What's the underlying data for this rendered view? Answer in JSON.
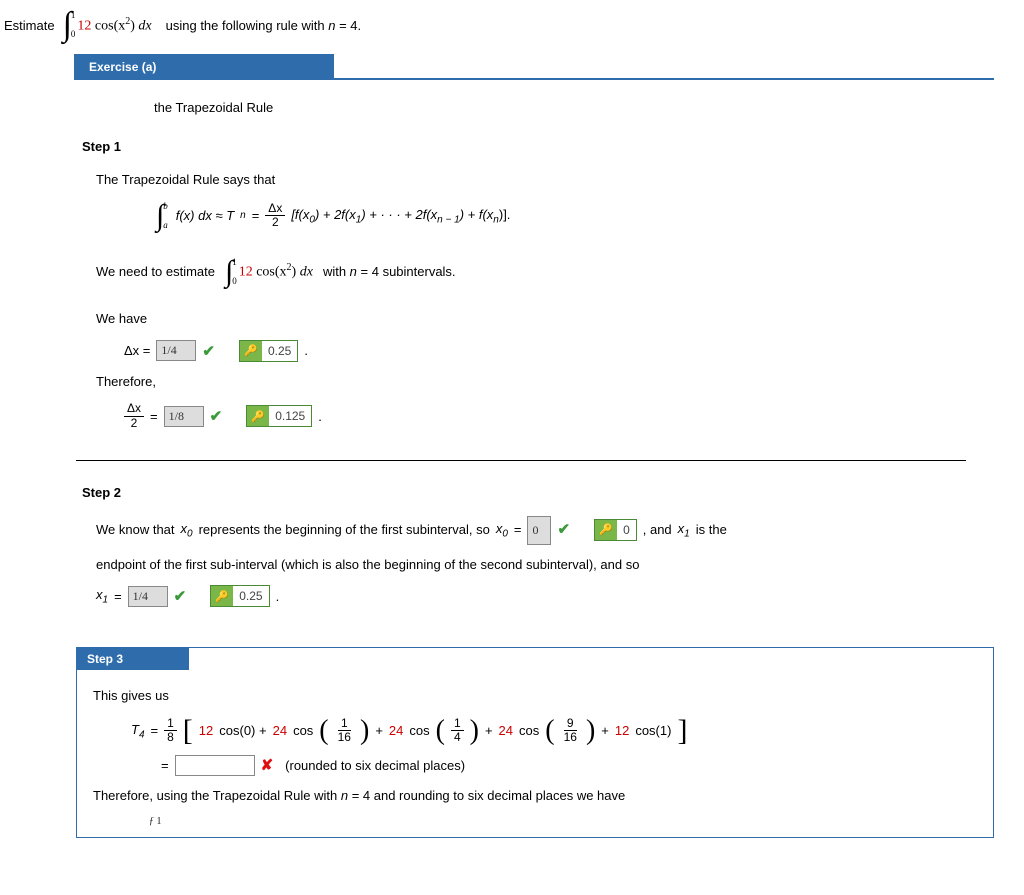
{
  "prompt": {
    "label": "Estimate",
    "integral_lower": "0",
    "integral_upper": "1",
    "coeff": "12",
    "func": "cos(x",
    "exp": "2",
    "closing": ")",
    "dx": " dx",
    "tail": "using the following rule with ",
    "nvar": "n",
    "tail2": " = 4."
  },
  "exercise": {
    "title": "Exercise (a)",
    "subtitle": "the Trapezoidal Rule"
  },
  "step1": {
    "title": "Step 1",
    "intro": "The Trapezoidal Rule says that",
    "rule_int_lower": "a",
    "rule_int_upper": "b",
    "rule_lhs": "f(x) dx ≈ T",
    "rule_n": "n",
    "rule_eq": " = ",
    "rule_frac_num": "Δx",
    "rule_frac_den": "2",
    "rule_body": " [f(x",
    "rule_0": "0",
    "rule_body2": ") + 2f(x",
    "rule_1": "1",
    "rule_body3": ") + · · · + 2f(x",
    "rule_nm1_a": "n",
    "rule_nm1_b": " − 1",
    "rule_body4": ") + f(x",
    "rule_body5": ")].",
    "need1": "We need to estimate",
    "need_lower": "0",
    "need_upper": "1",
    "need_coeff": "12",
    "need_func": "cos(x",
    "need_exp": "2",
    "need_close": ")",
    "need_dx": " dx",
    "need_tail1": "with ",
    "need_tail_n": "n",
    "need_tail2": " = 4 subintervals.",
    "wehave": "We have",
    "dx_label": "Δx = ",
    "dx_input": "1/4",
    "dx_decimal": "0.25",
    "period": " .",
    "therefore": "Therefore,",
    "dx2_num": "Δx",
    "dx2_den": "2",
    "dx2_eq": " = ",
    "dx2_input": "1/8",
    "dx2_decimal": "0.125"
  },
  "step2": {
    "title": "Step 2",
    "line1a": "We know that ",
    "x0": "x",
    "x0sub": "0",
    "line1b": " represents the beginning of the first subinterval, so ",
    "x0eq": " = ",
    "x0_input": "0",
    "x0_decimal": "0",
    "line1c": ", and ",
    "x1": "x",
    "x1sub": "1",
    "line1d": " is the",
    "line2": "endpoint of the first sub-interval (which is also the beginning of the second subinterval), and so",
    "x1eq": " = ",
    "x1_input": "1/4",
    "x1_decimal": "0.25"
  },
  "step3": {
    "title": "Step 3",
    "intro": "This gives us",
    "T": "T",
    "Tsub": "4",
    "eq": " = ",
    "frac_num": "1",
    "frac_den": "8",
    "c1": "12",
    "t1": " cos(0) + ",
    "c2": "24",
    "t2": " cos",
    "f2n": "1",
    "f2d": "16",
    "plus": " + ",
    "c3": "24",
    "f3n": "1",
    "f3d": "4",
    "c4": "24",
    "f4n": "9",
    "f4d": "16",
    "c5": "12",
    "t5": " cos(1)",
    "eq2": "=",
    "rounded": "(rounded to six decimal places)",
    "conclusion": "Therefore, using the Trapezoidal Rule with ",
    "conc_n": "n",
    "conclusion2": " = 4 and rounding to six decimal places we have"
  }
}
